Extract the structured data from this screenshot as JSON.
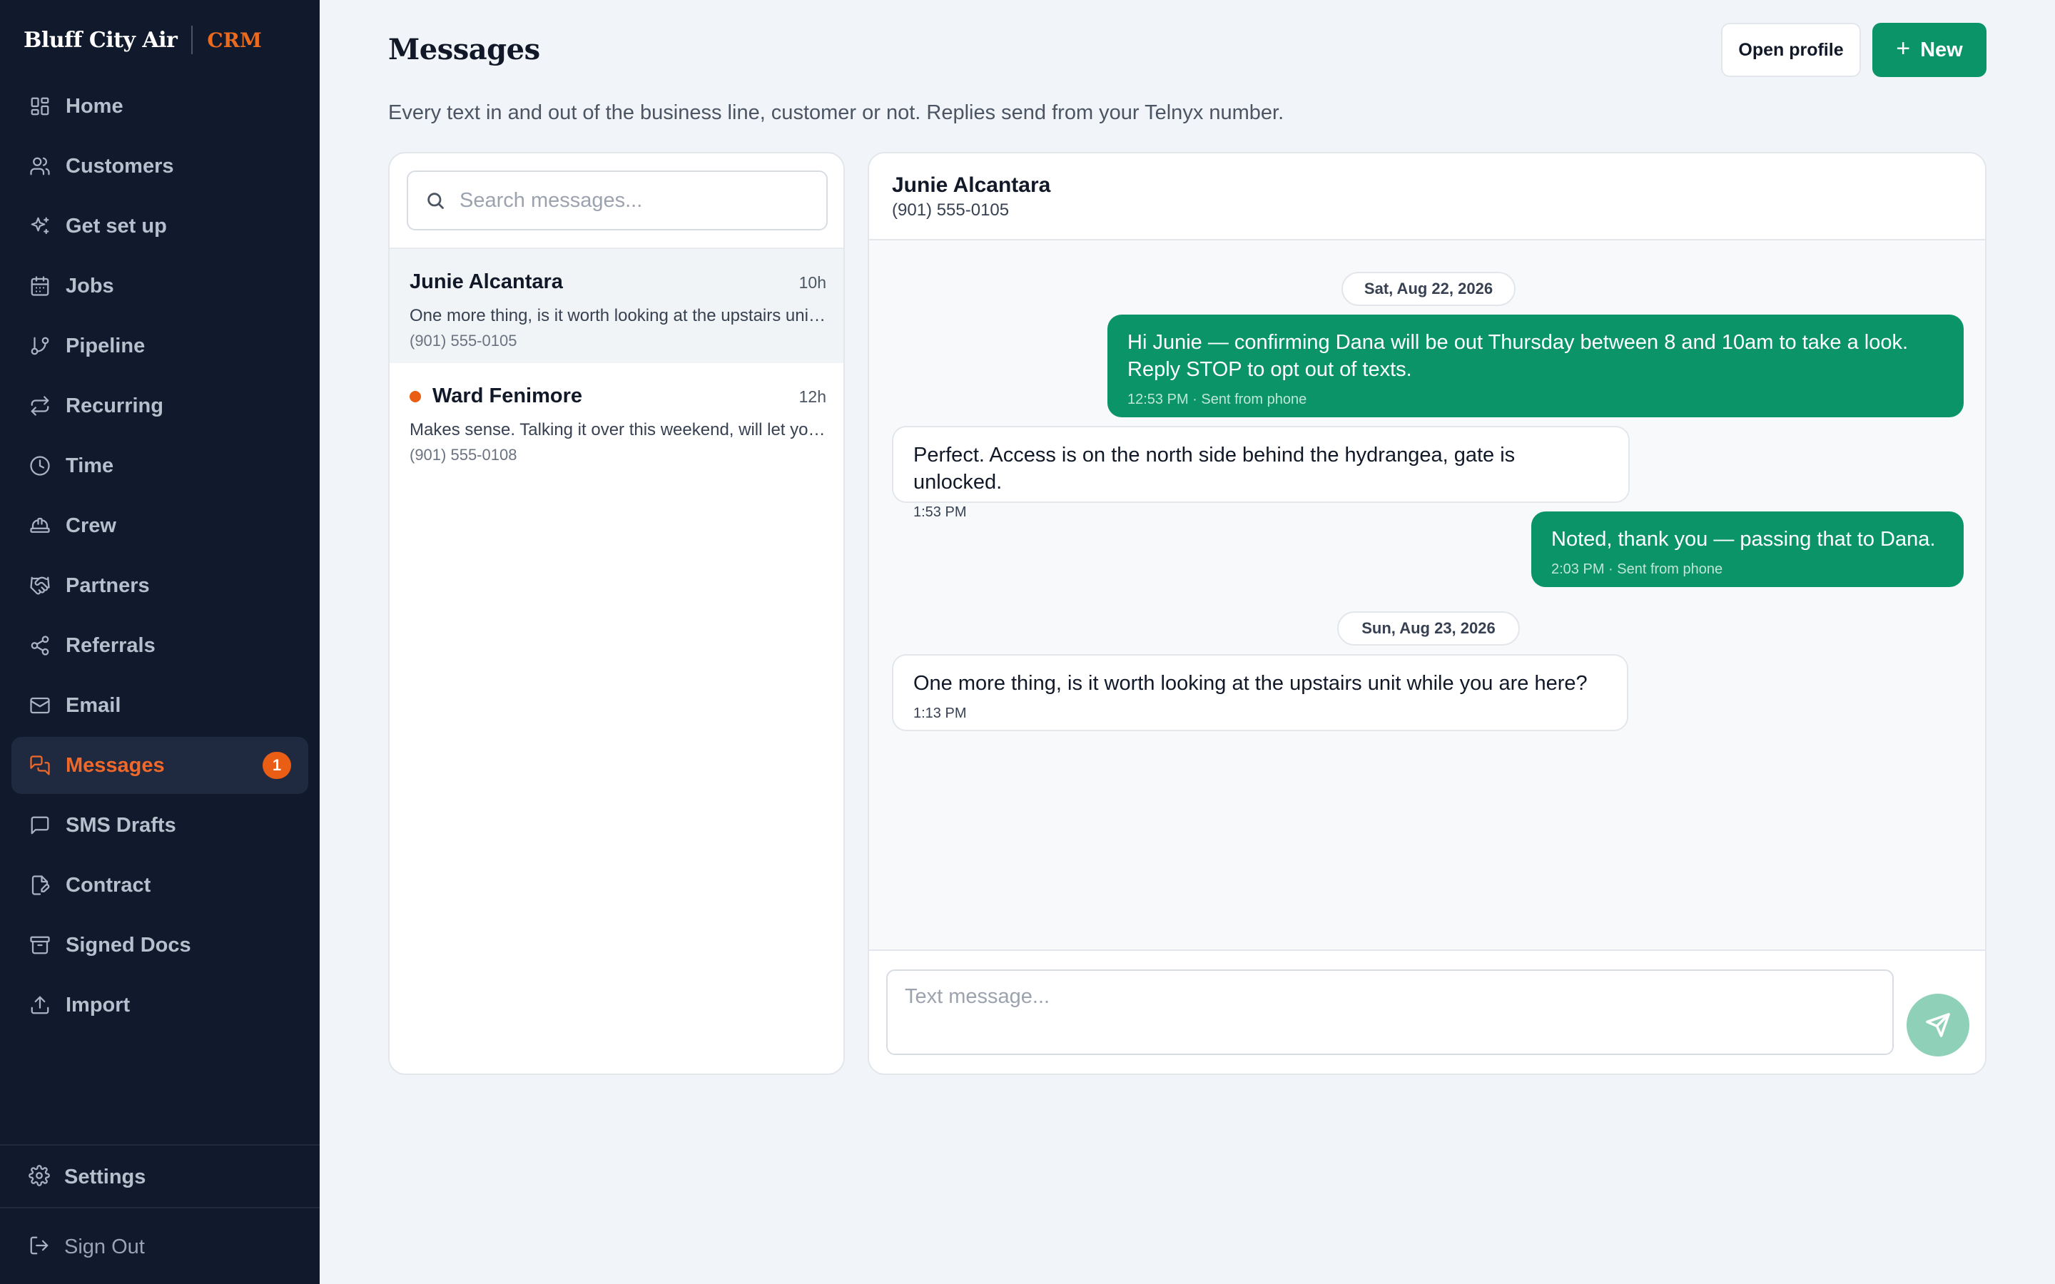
{
  "brand": {
    "name": "Bluff City Air",
    "tag": "CRM"
  },
  "sidebar": {
    "items": [
      {
        "label": "Home",
        "icon": "grid-icon"
      },
      {
        "label": "Customers",
        "icon": "users-icon"
      },
      {
        "label": "Get set up",
        "icon": "sparkles-icon"
      },
      {
        "label": "Jobs",
        "icon": "calendar-icon"
      },
      {
        "label": "Pipeline",
        "icon": "git-branch-icon"
      },
      {
        "label": "Recurring",
        "icon": "repeat-icon"
      },
      {
        "label": "Time",
        "icon": "clock-icon"
      },
      {
        "label": "Crew",
        "icon": "hard-hat-icon"
      },
      {
        "label": "Partners",
        "icon": "handshake-icon"
      },
      {
        "label": "Referrals",
        "icon": "share-icon"
      },
      {
        "label": "Email",
        "icon": "mail-icon"
      },
      {
        "label": "Messages",
        "icon": "messages-icon",
        "active": true,
        "badge": "1"
      },
      {
        "label": "SMS Drafts",
        "icon": "message-square-icon"
      },
      {
        "label": "Contract",
        "icon": "file-edit-icon"
      },
      {
        "label": "Signed Docs",
        "icon": "archive-icon"
      },
      {
        "label": "Import",
        "icon": "upload-icon"
      }
    ],
    "settings_label": "Settings",
    "signout_label": "Sign Out"
  },
  "header": {
    "title": "Messages",
    "subtitle": "Every text in and out of the business line, customer or not. Replies send from your Telnyx number.",
    "open_profile_label": "Open profile",
    "new_label": "New"
  },
  "search": {
    "placeholder": "Search messages..."
  },
  "conversations": [
    {
      "name": "Junie Alcantara",
      "time": "10h",
      "preview": "One more thing, is it worth looking at the upstairs unit while you are here?",
      "phone": "(901) 555-0105",
      "selected": true,
      "unread": false
    },
    {
      "name": "Ward Fenimore",
      "time": "12h",
      "preview": "Makes sense. Talking it over this weekend, will let you know.",
      "phone": "(901) 555-0108",
      "selected": false,
      "unread": true
    }
  ],
  "thread": {
    "name": "Junie Alcantara",
    "phone": "(901) 555-0105",
    "date_1": "Sat, Aug 22, 2026",
    "date_2": "Sun, Aug 23, 2026",
    "messages": [
      {
        "direction": "out",
        "text": "Hi Junie — confirming Dana will be out Thursday between 8 and 10am to take a look. Reply STOP to opt out of texts.",
        "meta": "12:53 PM · Sent from phone"
      },
      {
        "direction": "in",
        "text": "Perfect. Access is on the north side behind the hydrangea, gate is unlocked.",
        "meta": "1:53 PM"
      },
      {
        "direction": "out",
        "text": "Noted, thank you — passing that to Dana.",
        "meta": "2:03 PM · Sent from phone"
      },
      {
        "direction": "in",
        "text": "One more thing, is it worth looking at the upstairs unit while you are here?",
        "meta": "1:13 PM"
      }
    ]
  },
  "composer": {
    "placeholder": "Text message..."
  },
  "colors": {
    "accent_orange": "#ea5d14",
    "brand_green": "#0a9468",
    "sidebar_bg": "#111a2d",
    "page_bg": "#f1f4f8"
  }
}
